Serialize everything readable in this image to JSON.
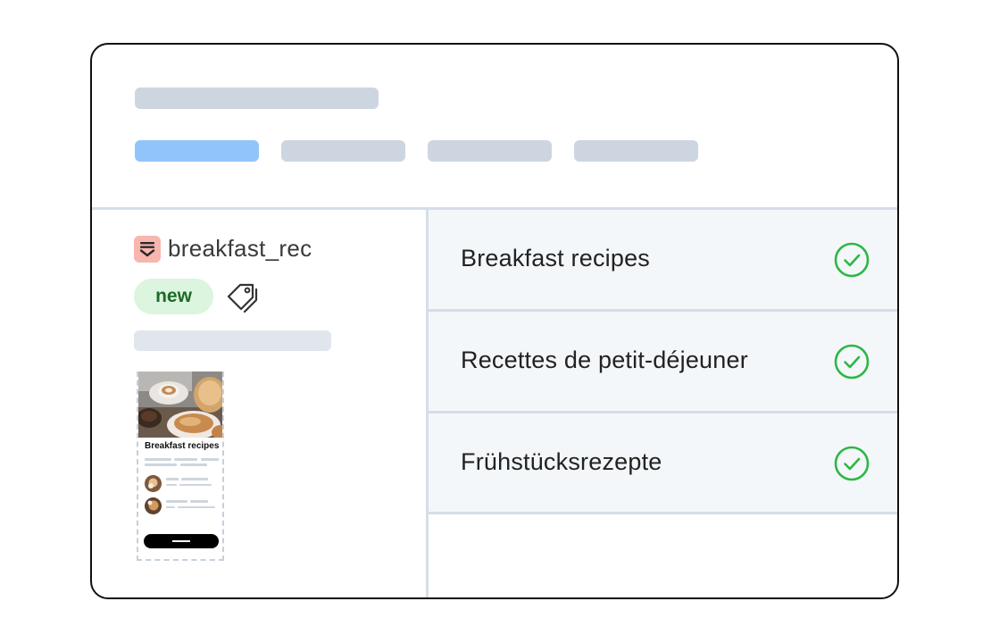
{
  "file": {
    "name": "breakfast_rec",
    "icon": "document-icon",
    "icon_color": "#f7b6ae"
  },
  "badge": {
    "label": "new",
    "bg": "#dcf5de",
    "color": "#1d6a2a"
  },
  "preview": {
    "title": "Breakfast recipes"
  },
  "translations": [
    {
      "label": "Breakfast recipes",
      "status_icon": "check-circle-icon"
    },
    {
      "label": "Recettes de petit-déjeuner",
      "status_icon": "check-circle-icon"
    },
    {
      "label": "Frühstücksrezepte",
      "status_icon": "check-circle-icon"
    }
  ],
  "colors": {
    "accent_tab": "#91c4fb",
    "placeholder": "#cdd6e0",
    "success": "#2bb843"
  }
}
